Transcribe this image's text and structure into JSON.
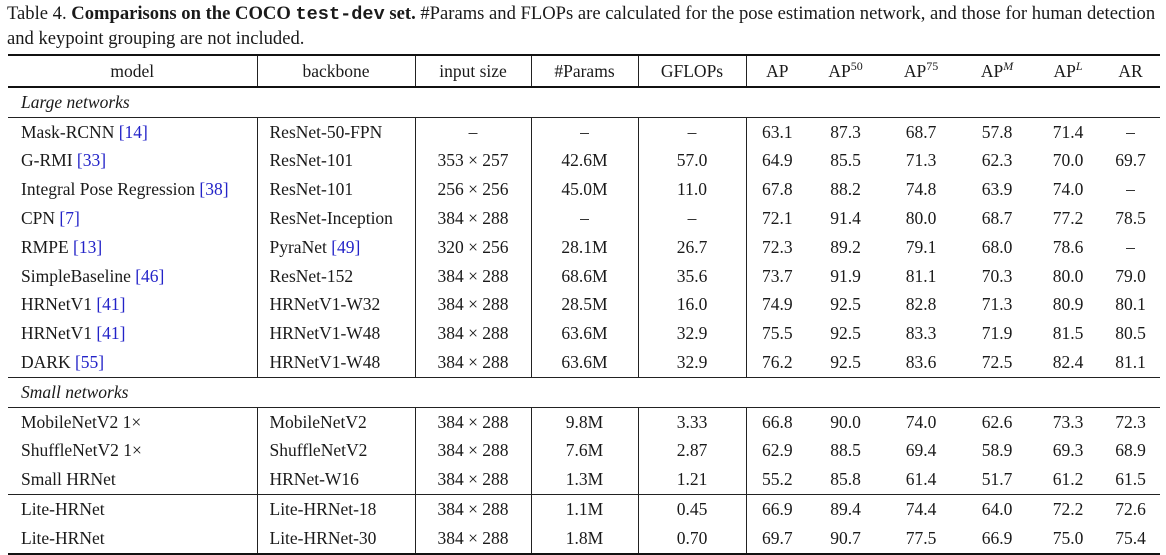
{
  "caption": {
    "prefix": "Table 4. ",
    "bold_start": "Comparisons on the COCO ",
    "bold_mono": "test-dev",
    "bold_end": " set.",
    "rest": " #Params and FLOPs are calculated for the pose estimation network, and those for human detection and keypoint grouping are not included."
  },
  "headers": {
    "model": "model",
    "backbone": "backbone",
    "input_size": "input size",
    "params": "#Params",
    "gflops": "GFLOPs",
    "ap": "AP",
    "ap50_base": "AP",
    "ap50_sup": "50",
    "ap75_base": "AP",
    "ap75_sup": "75",
    "apm_base": "AP",
    "apm_sup": "M",
    "apl_base": "AP",
    "apl_sup": "L",
    "ar": "AR"
  },
  "sections": {
    "large": "Large networks",
    "small": "Small networks"
  },
  "rows": [
    {
      "model": "Mask-RCNN",
      "ref": "[14]",
      "backbone": "ResNet-50-FPN",
      "backbone_ref": "",
      "input": "–",
      "params": "–",
      "gflops": "–",
      "ap": "63.1",
      "ap50": "87.3",
      "ap75": "68.7",
      "apm": "57.8",
      "apl": "71.4",
      "ar": "–"
    },
    {
      "model": "G-RMI",
      "ref": "[33]",
      "backbone": "ResNet-101",
      "backbone_ref": "",
      "input": "353 × 257",
      "params": "42.6M",
      "gflops": "57.0",
      "ap": "64.9",
      "ap50": "85.5",
      "ap75": "71.3",
      "apm": "62.3",
      "apl": "70.0",
      "ar": "69.7"
    },
    {
      "model": "Integral Pose Regression",
      "ref": "[38]",
      "backbone": "ResNet-101",
      "backbone_ref": "",
      "input": "256 × 256",
      "params": "45.0M",
      "gflops": "11.0",
      "ap": "67.8",
      "ap50": "88.2",
      "ap75": "74.8",
      "apm": "63.9",
      "apl": "74.0",
      "ar": "–"
    },
    {
      "model": "CPN",
      "ref": "[7]",
      "backbone": "ResNet-Inception",
      "backbone_ref": "",
      "input": "384 × 288",
      "params": "–",
      "gflops": "–",
      "ap": "72.1",
      "ap50": "91.4",
      "ap75": "80.0",
      "apm": "68.7",
      "apl": "77.2",
      "ar": "78.5"
    },
    {
      "model": "RMPE",
      "ref": "[13]",
      "backbone": "PyraNet",
      "backbone_ref": "[49]",
      "input": "320 × 256",
      "params": "28.1M",
      "gflops": "26.7",
      "ap": "72.3",
      "ap50": "89.2",
      "ap75": "79.1",
      "apm": "68.0",
      "apl": "78.6",
      "ar": "–"
    },
    {
      "model": "SimpleBaseline",
      "ref": "[46]",
      "backbone": "ResNet-152",
      "backbone_ref": "",
      "input": "384 × 288",
      "params": "68.6M",
      "gflops": "35.6",
      "ap": "73.7",
      "ap50": "91.9",
      "ap75": "81.1",
      "apm": "70.3",
      "apl": "80.0",
      "ar": "79.0"
    },
    {
      "model": "HRNetV1",
      "ref": "[41]",
      "backbone": "HRNetV1-W32",
      "backbone_ref": "",
      "input": "384 × 288",
      "params": "28.5M",
      "gflops": "16.0",
      "ap": "74.9",
      "ap50": "92.5",
      "ap75": "82.8",
      "apm": "71.3",
      "apl": "80.9",
      "ar": "80.1"
    },
    {
      "model": "HRNetV1",
      "ref": "[41]",
      "backbone": "HRNetV1-W48",
      "backbone_ref": "",
      "input": "384 × 288",
      "params": "63.6M",
      "gflops": "32.9",
      "ap": "75.5",
      "ap50": "92.5",
      "ap75": "83.3",
      "apm": "71.9",
      "apl": "81.5",
      "ar": "80.5"
    },
    {
      "model": "DARK",
      "ref": "[55]",
      "backbone": "HRNetV1-W48",
      "backbone_ref": "",
      "input": "384 × 288",
      "params": "63.6M",
      "gflops": "32.9",
      "ap": "76.2",
      "ap50": "92.5",
      "ap75": "83.6",
      "apm": "72.5",
      "apl": "82.4",
      "ar": "81.1"
    },
    {
      "model": "MobileNetV2 1×",
      "ref": "",
      "backbone": "MobileNetV2",
      "backbone_ref": "",
      "input": "384 × 288",
      "params": "9.8M",
      "gflops": "3.33",
      "ap": "66.8",
      "ap50": "90.0",
      "ap75": "74.0",
      "apm": "62.6",
      "apl": "73.3",
      "ar": "72.3"
    },
    {
      "model": "ShuffleNetV2 1×",
      "ref": "",
      "backbone": "ShuffleNetV2",
      "backbone_ref": "",
      "input": "384 × 288",
      "params": "7.6M",
      "gflops": "2.87",
      "ap": "62.9",
      "ap50": "88.5",
      "ap75": "69.4",
      "apm": "58.9",
      "apl": "69.3",
      "ar": "68.9"
    },
    {
      "model": "Small HRNet",
      "ref": "",
      "backbone": "HRNet-W16",
      "backbone_ref": "",
      "input": "384 × 288",
      "params": "1.3M",
      "gflops": "1.21",
      "ap": "55.2",
      "ap50": "85.8",
      "ap75": "61.4",
      "apm": "51.7",
      "apl": "61.2",
      "ar": "61.5"
    },
    {
      "model": "Lite-HRNet",
      "ref": "",
      "backbone": "Lite-HRNet-18",
      "backbone_ref": "",
      "input": "384 × 288",
      "params": "1.1M",
      "gflops": "0.45",
      "ap": "66.9",
      "ap50": "89.4",
      "ap75": "74.4",
      "apm": "64.0",
      "apl": "72.2",
      "ar": "72.6"
    },
    {
      "model": "Lite-HRNet",
      "ref": "",
      "backbone": "Lite-HRNet-30",
      "backbone_ref": "",
      "input": "384 × 288",
      "params": "1.8M",
      "gflops": "0.70",
      "ap": "69.7",
      "ap50": "90.7",
      "ap75": "77.5",
      "apm": "66.9",
      "apl": "75.0",
      "ar": "75.4"
    }
  ],
  "colors": {
    "reference_link": "#2323c8",
    "text": "#1a1a1a",
    "rules": "#111111"
  }
}
